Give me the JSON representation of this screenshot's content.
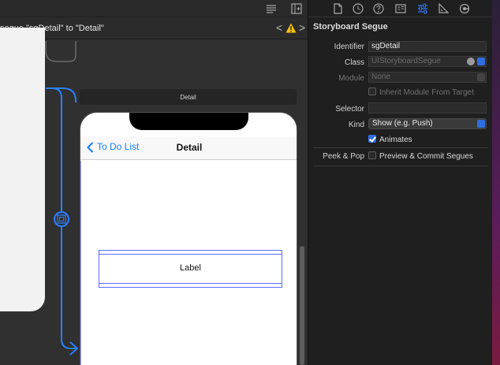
{
  "canvas": {
    "breadcrumb_text": "segue \"sgDetail\" to \"Detail\"",
    "nav_prev": "<",
    "nav_next": ">",
    "detail_scene_title": "Detail",
    "phone": {
      "back_label": "To Do List",
      "nav_title": "Detail",
      "label_text": "Label"
    }
  },
  "inspector": {
    "section_title": "Storyboard Segue",
    "identifier_label": "Identifier",
    "identifier_value": "sgDetail",
    "class_label": "Class",
    "class_placeholder": "UIStoryboardSegue",
    "module_label": "Module",
    "module_placeholder": "None",
    "inherit_label": "Inherit Module From Target",
    "selector_label": "Selector",
    "selector_value": "",
    "kind_label": "Kind",
    "kind_value": "Show (e.g. Push)",
    "animates_label": "Animates",
    "animates_checked": true,
    "peek_label": "Peek & Pop",
    "peek_option": "Preview & Commit Segues",
    "peek_checked": false
  },
  "colors": {
    "accent": "#2f6ee0",
    "link": "#1a7cff",
    "segue_line": "#2a7fff",
    "warning": "#f4c20d"
  }
}
